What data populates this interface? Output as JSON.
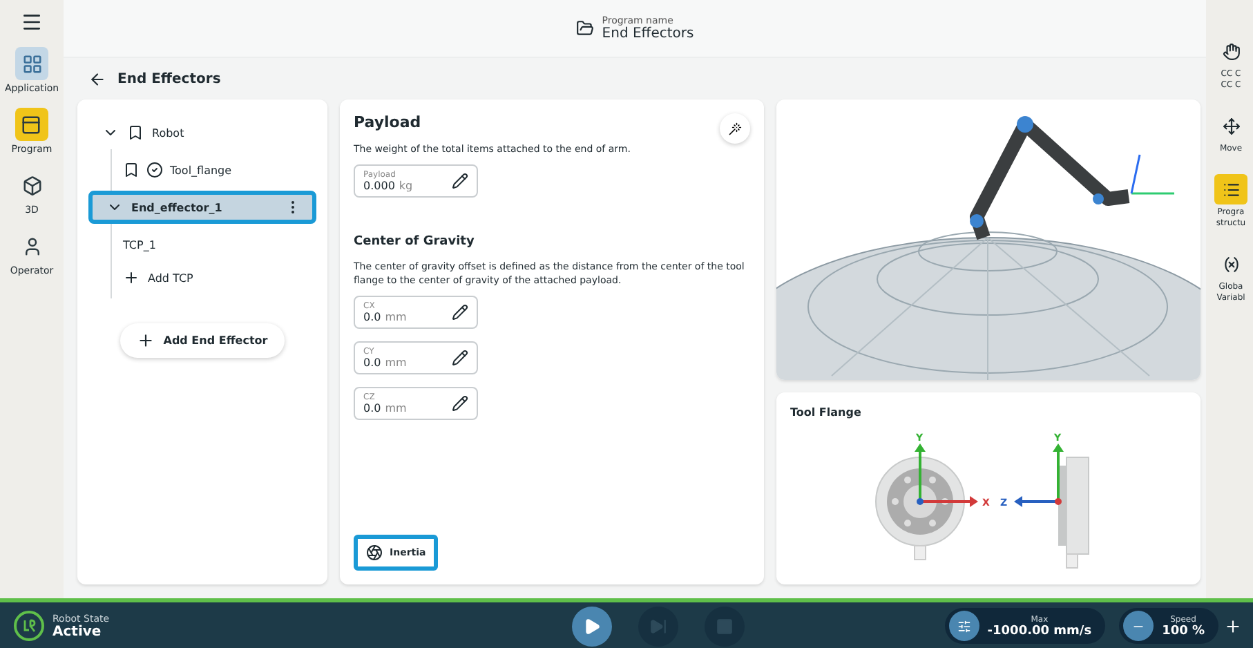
{
  "nav": {
    "items": [
      {
        "label": "Application",
        "kind": "grid",
        "selected": true,
        "accent": false
      },
      {
        "label": "Program",
        "kind": "program",
        "selected": false,
        "accent": true
      },
      {
        "label": "3D",
        "kind": "cube",
        "selected": false,
        "accent": false
      },
      {
        "label": "Operator",
        "kind": "user",
        "selected": false,
        "accent": false
      }
    ]
  },
  "header": {
    "caption": "Program name",
    "title": "End Effectors"
  },
  "page_title": "End Effectors",
  "tree": {
    "nodes": [
      {
        "label": "Robot",
        "kind": "robot",
        "expanded": true,
        "selected": false,
        "children": [
          {
            "label": "Tool_flange",
            "kind": "flange"
          }
        ]
      },
      {
        "label": "End_effector_1",
        "kind": "effector",
        "expanded": true,
        "selected": true,
        "children": [
          {
            "label": "TCP_1",
            "kind": "tcp"
          },
          {
            "label": "Add TCP",
            "kind": "add"
          }
        ]
      }
    ],
    "add_button": "Add End Effector"
  },
  "payload": {
    "title": "Payload",
    "description": "The weight of the total items attached to the end of arm.",
    "field": {
      "label": "Payload",
      "value": "0.000",
      "unit": "kg"
    }
  },
  "gravity": {
    "title": "Center of Gravity",
    "description": "The center of gravity offset is defined as the distance from the center of the tool flange to the center of gravity of the attached payload.",
    "fields": [
      {
        "label": "CX",
        "value": "0.0",
        "unit": "mm"
      },
      {
        "label": "CY",
        "value": "0.0",
        "unit": "mm"
      },
      {
        "label": "CZ",
        "value": "0.0",
        "unit": "mm"
      }
    ]
  },
  "inertia_button": "Inertia",
  "tool_flange": {
    "title": "Tool Flange",
    "axes": {
      "front_y": "Y",
      "front_x": "X",
      "side_y": "Y",
      "side_z": "Z"
    }
  },
  "right_bar": {
    "items": [
      {
        "lines": [
          "CC C",
          "CC C"
        ],
        "kind": "hand",
        "accent": false
      },
      {
        "lines": [
          "Move"
        ],
        "kind": "move",
        "accent": false
      },
      {
        "lines": [
          "Progra",
          "structu"
        ],
        "kind": "list",
        "accent": true
      },
      {
        "lines": [
          "Globa",
          "Variabl"
        ],
        "kind": "variable",
        "accent": false
      }
    ]
  },
  "status_bar": {
    "state_label": "Robot State",
    "state_value": "Active",
    "controls": [
      {
        "kind": "play",
        "disabled": false
      },
      {
        "kind": "step",
        "disabled": true
      },
      {
        "kind": "stop",
        "disabled": true
      }
    ],
    "max": {
      "label": "Max",
      "value": "-1000.00 mm/s"
    },
    "speed": {
      "label": "Speed",
      "value": "100 %"
    }
  }
}
